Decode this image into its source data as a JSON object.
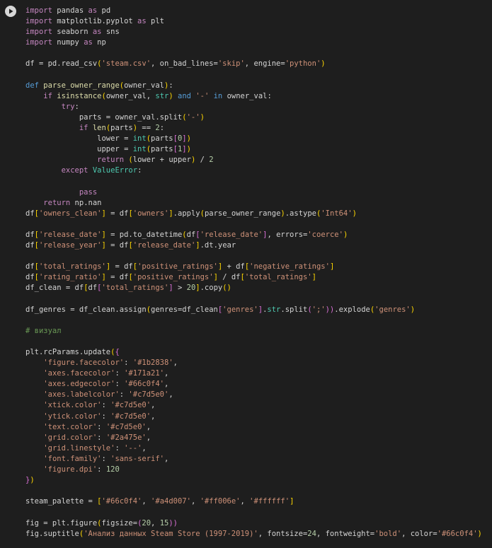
{
  "cell": {
    "run_button_icon": "play-icon",
    "language": "python"
  },
  "colors": {
    "background": "#1e1e1e",
    "keyword": "#569cd6",
    "control_keyword": "#c586c0",
    "function": "#dcdcaa",
    "builtin": "#4ec9b0",
    "string": "#ce9178",
    "number": "#b5cea8",
    "comment": "#6a9955",
    "text": "#d4d4d4"
  },
  "code_lines": [
    [
      [
        "kw2",
        "import"
      ],
      [
        "pl",
        " pandas "
      ],
      [
        "kw2",
        "as"
      ],
      [
        "pl",
        " pd"
      ]
    ],
    [
      [
        "kw2",
        "import"
      ],
      [
        "pl",
        " matplotlib.pyplot "
      ],
      [
        "kw2",
        "as"
      ],
      [
        "pl",
        " plt"
      ]
    ],
    [
      [
        "kw2",
        "import"
      ],
      [
        "pl",
        " seaborn "
      ],
      [
        "kw2",
        "as"
      ],
      [
        "pl",
        " sns"
      ]
    ],
    [
      [
        "kw2",
        "import"
      ],
      [
        "pl",
        " numpy "
      ],
      [
        "kw2",
        "as"
      ],
      [
        "pl",
        " np"
      ]
    ],
    [],
    [
      [
        "pl",
        "df = pd.read_csv"
      ],
      [
        "br1",
        "("
      ],
      [
        "str",
        "'steam.csv'"
      ],
      [
        "pl",
        ", on_bad_lines="
      ],
      [
        "str",
        "'skip'"
      ],
      [
        "pl",
        ", engine="
      ],
      [
        "str",
        "'python'"
      ],
      [
        "br1",
        ")"
      ]
    ],
    [],
    [
      [
        "kw",
        "def"
      ],
      [
        "pl",
        " "
      ],
      [
        "fn",
        "parse_owner_range"
      ],
      [
        "br1",
        "("
      ],
      [
        "pl",
        "owner_val"
      ],
      [
        "br1",
        ")"
      ],
      [
        "pl",
        ":"
      ]
    ],
    [
      [
        "pl",
        "    "
      ],
      [
        "kw2",
        "if"
      ],
      [
        "pl",
        " "
      ],
      [
        "fn",
        "isinstance"
      ],
      [
        "br1",
        "("
      ],
      [
        "pl",
        "owner_val, "
      ],
      [
        "bi",
        "str"
      ],
      [
        "br1",
        ")"
      ],
      [
        "pl",
        " "
      ],
      [
        "kw",
        "and"
      ],
      [
        "pl",
        " "
      ],
      [
        "str",
        "'-'"
      ],
      [
        "pl",
        " "
      ],
      [
        "kw",
        "in"
      ],
      [
        "pl",
        " owner_val:"
      ]
    ],
    [
      [
        "pl",
        "        "
      ],
      [
        "kw2",
        "try"
      ],
      [
        "pl",
        ":"
      ]
    ],
    [
      [
        "pl",
        "            parts = owner_val.split"
      ],
      [
        "br1",
        "("
      ],
      [
        "str",
        "'-'"
      ],
      [
        "br1",
        ")"
      ]
    ],
    [
      [
        "pl",
        "            "
      ],
      [
        "kw2",
        "if"
      ],
      [
        "pl",
        " "
      ],
      [
        "fn",
        "len"
      ],
      [
        "br1",
        "("
      ],
      [
        "pl",
        "parts"
      ],
      [
        "br1",
        ")"
      ],
      [
        "pl",
        " == "
      ],
      [
        "num",
        "2"
      ],
      [
        "pl",
        ":"
      ]
    ],
    [
      [
        "pl",
        "                lower = "
      ],
      [
        "bi",
        "int"
      ],
      [
        "br1",
        "("
      ],
      [
        "pl",
        "parts"
      ],
      [
        "br2",
        "["
      ],
      [
        "num",
        "0"
      ],
      [
        "br2",
        "]"
      ],
      [
        "br1",
        ")"
      ]
    ],
    [
      [
        "pl",
        "                upper = "
      ],
      [
        "bi",
        "int"
      ],
      [
        "br1",
        "("
      ],
      [
        "pl",
        "parts"
      ],
      [
        "br2",
        "["
      ],
      [
        "num",
        "1"
      ],
      [
        "br2",
        "]"
      ],
      [
        "br1",
        ")"
      ]
    ],
    [
      [
        "pl",
        "                "
      ],
      [
        "kw2",
        "return"
      ],
      [
        "pl",
        " "
      ],
      [
        "br1",
        "("
      ],
      [
        "pl",
        "lower + upper"
      ],
      [
        "br1",
        ")"
      ],
      [
        "pl",
        " / "
      ],
      [
        "num",
        "2"
      ]
    ],
    [
      [
        "pl",
        "        "
      ],
      [
        "kw2",
        "except"
      ],
      [
        "pl",
        " "
      ],
      [
        "bi",
        "ValueError"
      ],
      [
        "pl",
        ":"
      ]
    ],
    [],
    [
      [
        "pl",
        "            "
      ],
      [
        "kw2",
        "pass"
      ]
    ],
    [
      [
        "pl",
        "    "
      ],
      [
        "kw2",
        "return"
      ],
      [
        "pl",
        " np.nan"
      ]
    ],
    [
      [
        "pl",
        "df"
      ],
      [
        "br1",
        "["
      ],
      [
        "str",
        "'owners_clean'"
      ],
      [
        "br1",
        "]"
      ],
      [
        "pl",
        " = df"
      ],
      [
        "br1",
        "["
      ],
      [
        "str",
        "'owners'"
      ],
      [
        "br1",
        "]"
      ],
      [
        "pl",
        ".apply"
      ],
      [
        "br1",
        "("
      ],
      [
        "pl",
        "parse_owner_range"
      ],
      [
        "br1",
        ")"
      ],
      [
        "pl",
        ".astype"
      ],
      [
        "br1",
        "("
      ],
      [
        "str",
        "'Int64'"
      ],
      [
        "br1",
        ")"
      ]
    ],
    [],
    [
      [
        "pl",
        "df"
      ],
      [
        "br1",
        "["
      ],
      [
        "str",
        "'release_date'"
      ],
      [
        "br1",
        "]"
      ],
      [
        "pl",
        " = pd.to_datetime"
      ],
      [
        "br1",
        "("
      ],
      [
        "pl",
        "df"
      ],
      [
        "br2",
        "["
      ],
      [
        "str",
        "'release_date'"
      ],
      [
        "br2",
        "]"
      ],
      [
        "pl",
        ", errors="
      ],
      [
        "str",
        "'coerce'"
      ],
      [
        "br1",
        ")"
      ]
    ],
    [
      [
        "pl",
        "df"
      ],
      [
        "br1",
        "["
      ],
      [
        "str",
        "'release_year'"
      ],
      [
        "br1",
        "]"
      ],
      [
        "pl",
        " = df"
      ],
      [
        "br1",
        "["
      ],
      [
        "str",
        "'release_date'"
      ],
      [
        "br1",
        "]"
      ],
      [
        "pl",
        ".dt.year"
      ]
    ],
    [],
    [
      [
        "pl",
        "df"
      ],
      [
        "br1",
        "["
      ],
      [
        "str",
        "'total_ratings'"
      ],
      [
        "br1",
        "]"
      ],
      [
        "pl",
        " = df"
      ],
      [
        "br1",
        "["
      ],
      [
        "str",
        "'positive_ratings'"
      ],
      [
        "br1",
        "]"
      ],
      [
        "pl",
        " + df"
      ],
      [
        "br1",
        "["
      ],
      [
        "str",
        "'negative_ratings'"
      ],
      [
        "br1",
        "]"
      ]
    ],
    [
      [
        "pl",
        "df"
      ],
      [
        "br1",
        "["
      ],
      [
        "str",
        "'rating_ratio'"
      ],
      [
        "br1",
        "]"
      ],
      [
        "pl",
        " = df"
      ],
      [
        "br1",
        "["
      ],
      [
        "str",
        "'positive_ratings'"
      ],
      [
        "br1",
        "]"
      ],
      [
        "pl",
        " / df"
      ],
      [
        "br1",
        "["
      ],
      [
        "str",
        "'total_ratings'"
      ],
      [
        "br1",
        "]"
      ]
    ],
    [
      [
        "pl",
        "df_clean = df"
      ],
      [
        "br1",
        "["
      ],
      [
        "pl",
        "df"
      ],
      [
        "br2",
        "["
      ],
      [
        "str",
        "'total_ratings'"
      ],
      [
        "br2",
        "]"
      ],
      [
        "pl",
        " > "
      ],
      [
        "num",
        "20"
      ],
      [
        "br1",
        "]"
      ],
      [
        "pl",
        ".copy"
      ],
      [
        "br1",
        "()"
      ]
    ],
    [],
    [
      [
        "pl",
        "df_genres = df_clean.assign"
      ],
      [
        "br1",
        "("
      ],
      [
        "pl",
        "genres=df_clean"
      ],
      [
        "br2",
        "["
      ],
      [
        "str",
        "'genres'"
      ],
      [
        "br2",
        "]"
      ],
      [
        "pl",
        "."
      ],
      [
        "bi",
        "str"
      ],
      [
        "pl",
        ".split"
      ],
      [
        "br2",
        "("
      ],
      [
        "str",
        "';'"
      ],
      [
        "br2",
        "))"
      ],
      [
        "pl",
        ".explode"
      ],
      [
        "br1",
        "("
      ],
      [
        "str",
        "'genres'"
      ],
      [
        "br1",
        ")"
      ]
    ],
    [],
    [
      [
        "cm",
        "# визуал"
      ]
    ],
    [],
    [
      [
        "pl",
        "plt.rcParams.update"
      ],
      [
        "br1",
        "("
      ],
      [
        "br2",
        "{"
      ]
    ],
    [
      [
        "pl",
        "    "
      ],
      [
        "str",
        "'figure.facecolor'"
      ],
      [
        "pl",
        ": "
      ],
      [
        "str",
        "'#1b2838'"
      ],
      [
        "pl",
        ","
      ]
    ],
    [
      [
        "pl",
        "    "
      ],
      [
        "str",
        "'axes.facecolor'"
      ],
      [
        "pl",
        ": "
      ],
      [
        "str",
        "'#171a21'"
      ],
      [
        "pl",
        ","
      ]
    ],
    [
      [
        "pl",
        "    "
      ],
      [
        "str",
        "'axes.edgecolor'"
      ],
      [
        "pl",
        ": "
      ],
      [
        "str",
        "'#66c0f4'"
      ],
      [
        "pl",
        ","
      ]
    ],
    [
      [
        "pl",
        "    "
      ],
      [
        "str",
        "'axes.labelcolor'"
      ],
      [
        "pl",
        ": "
      ],
      [
        "str",
        "'#c7d5e0'"
      ],
      [
        "pl",
        ","
      ]
    ],
    [
      [
        "pl",
        "    "
      ],
      [
        "str",
        "'xtick.color'"
      ],
      [
        "pl",
        ": "
      ],
      [
        "str",
        "'#c7d5e0'"
      ],
      [
        "pl",
        ","
      ]
    ],
    [
      [
        "pl",
        "    "
      ],
      [
        "str",
        "'ytick.color'"
      ],
      [
        "pl",
        ": "
      ],
      [
        "str",
        "'#c7d5e0'"
      ],
      [
        "pl",
        ","
      ]
    ],
    [
      [
        "pl",
        "    "
      ],
      [
        "str",
        "'text.color'"
      ],
      [
        "pl",
        ": "
      ],
      [
        "str",
        "'#c7d5e0'"
      ],
      [
        "pl",
        ","
      ]
    ],
    [
      [
        "pl",
        "    "
      ],
      [
        "str",
        "'grid.color'"
      ],
      [
        "pl",
        ": "
      ],
      [
        "str",
        "'#2a475e'"
      ],
      [
        "pl",
        ","
      ]
    ],
    [
      [
        "pl",
        "    "
      ],
      [
        "str",
        "'grid.linestyle'"
      ],
      [
        "pl",
        ": "
      ],
      [
        "str",
        "'--'"
      ],
      [
        "pl",
        ","
      ]
    ],
    [
      [
        "pl",
        "    "
      ],
      [
        "str",
        "'font.family'"
      ],
      [
        "pl",
        ": "
      ],
      [
        "str",
        "'sans-serif'"
      ],
      [
        "pl",
        ","
      ]
    ],
    [
      [
        "pl",
        "    "
      ],
      [
        "str",
        "'figure.dpi'"
      ],
      [
        "pl",
        ": "
      ],
      [
        "num",
        "120"
      ]
    ],
    [
      [
        "br2",
        "}"
      ],
      [
        "br1",
        ")"
      ]
    ],
    [],
    [
      [
        "pl",
        "steam_palette = "
      ],
      [
        "br1",
        "["
      ],
      [
        "str",
        "'#66c0f4'"
      ],
      [
        "pl",
        ", "
      ],
      [
        "str",
        "'#a4d007'"
      ],
      [
        "pl",
        ", "
      ],
      [
        "str",
        "'#ff006e'"
      ],
      [
        "pl",
        ", "
      ],
      [
        "str",
        "'#ffffff'"
      ],
      [
        "br1",
        "]"
      ]
    ],
    [],
    [
      [
        "pl",
        "fig = plt.figure"
      ],
      [
        "br1",
        "("
      ],
      [
        "pl",
        "figsize="
      ],
      [
        "br2",
        "("
      ],
      [
        "num",
        "20"
      ],
      [
        "pl",
        ", "
      ],
      [
        "num",
        "15"
      ],
      [
        "br2",
        "))"
      ]
    ],
    [
      [
        "pl",
        "fig.suptitle"
      ],
      [
        "br1",
        "("
      ],
      [
        "str",
        "'Анализ данных Steam Store (1997-2019)'"
      ],
      [
        "pl",
        ", fontsize="
      ],
      [
        "num",
        "24"
      ],
      [
        "pl",
        ", fontweight="
      ],
      [
        "str",
        "'bold'"
      ],
      [
        "pl",
        ", color="
      ],
      [
        "str",
        "'#66c0f4'"
      ],
      [
        "br1",
        ")"
      ]
    ]
  ]
}
